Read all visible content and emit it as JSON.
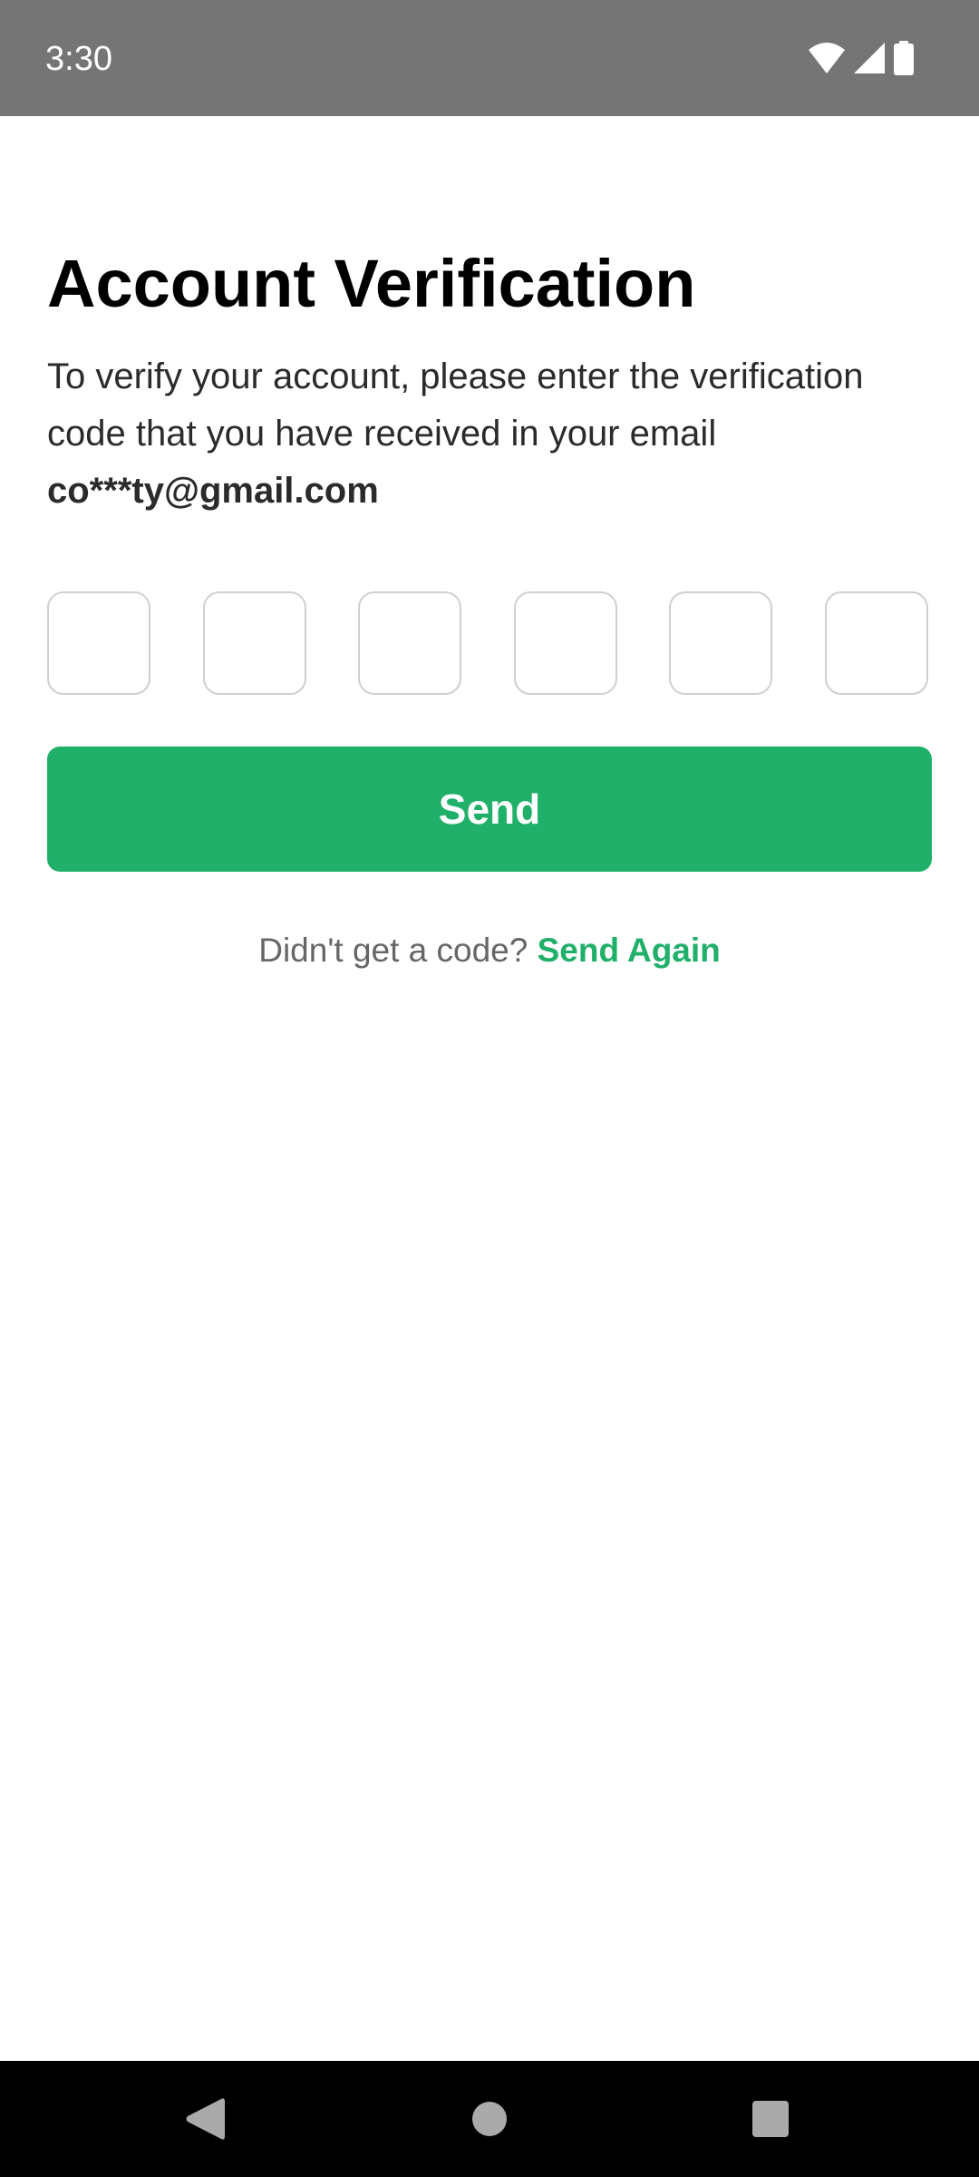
{
  "status_bar": {
    "time": "3:30",
    "icons": [
      "wifi-icon",
      "cellular-signal-icon",
      "battery-icon"
    ]
  },
  "page": {
    "title": "Account Verification",
    "description": "To verify your account, please enter the verification code that you have received in your email",
    "email": "co***ty@gmail.com"
  },
  "otp": {
    "digit_count": 6,
    "values": [
      "",
      "",
      "",
      "",
      "",
      ""
    ]
  },
  "actions": {
    "send_label": "Send",
    "resend_prompt": "Didn't get a code?",
    "resend_link": "Send Again"
  },
  "navigation": {
    "buttons": [
      "back-icon",
      "home-icon",
      "recents-icon"
    ]
  },
  "colors": {
    "accent": "#21b06a",
    "status_bar": "#757575",
    "nav_bar": "#000000",
    "text_primary": "#000000",
    "text_secondary": "#666666",
    "box_border": "#cfcfcf"
  }
}
